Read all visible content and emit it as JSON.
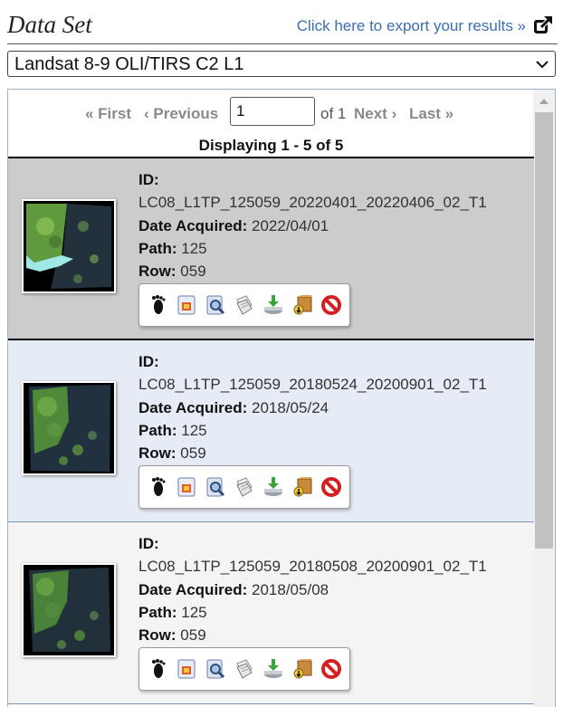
{
  "header": {
    "title": "Data Set",
    "export_label": "Click here to export your results »"
  },
  "dataset_select": {
    "selected": "Landsat 8-9 OLI/TIRS C2 L1"
  },
  "pager": {
    "first": "« First",
    "previous": "‹ Previous",
    "page": "1",
    "of": "of 1",
    "next": "Next ›",
    "last": "Last »",
    "displaying": "Displaying 1 - 5 of 5"
  },
  "labels": {
    "id": "ID:",
    "date": "Date Acquired:",
    "path": "Path:",
    "row": "Row:"
  },
  "results": [
    {
      "id": "LC08_L1TP_125059_20220401_20220406_02_T1",
      "date": "2022/04/01",
      "path": "125",
      "row": "059"
    },
    {
      "id": "LC08_L1TP_125059_20180524_20200901_02_T1",
      "date": "2018/05/24",
      "path": "125",
      "row": "059"
    },
    {
      "id": "LC08_L1TP_125059_20180508_20200901_02_T1",
      "date": "2018/05/08",
      "path": "125",
      "row": "059"
    }
  ],
  "toolbar_icons": [
    "footprint-icon",
    "overlay-icon",
    "show-metadata-icon",
    "compare-icon",
    "download-icon",
    "order-icon",
    "exclude-icon"
  ],
  "colors": {
    "link": "#3b6fb5",
    "selected_row": "#cccccc",
    "alt_row": "#e6ecf6"
  }
}
